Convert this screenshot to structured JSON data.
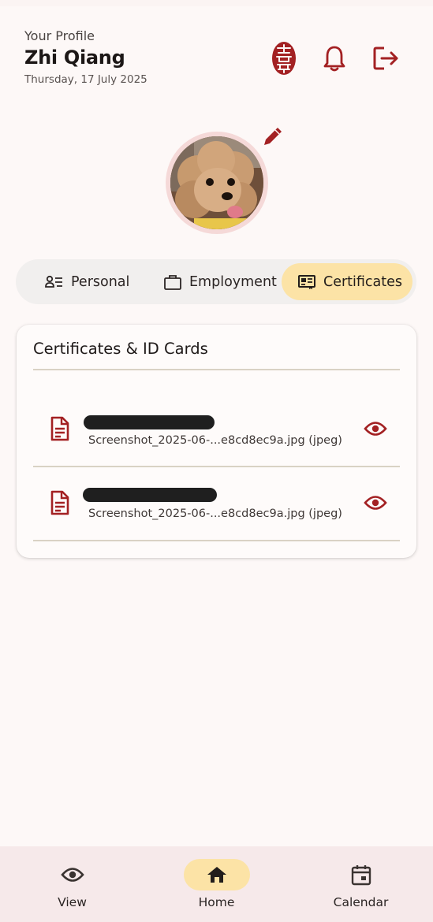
{
  "header": {
    "eyebrow": "Your Profile",
    "name": "Zhi Qiang",
    "date": "Thursday, 17 July 2025"
  },
  "icons": {
    "seal": "seal-logo-icon",
    "notifications": "bell-icon",
    "logout": "logout-icon",
    "edit": "pencil-icon"
  },
  "tabs": [
    {
      "label": "Personal",
      "icon": "person-list-icon",
      "active": false
    },
    {
      "label": "Employment",
      "icon": "briefcase-icon",
      "active": false
    },
    {
      "label": "Certificates",
      "icon": "id-card-icon",
      "active": true
    }
  ],
  "certificates": {
    "title": "Certificates & ID Cards",
    "items": [
      {
        "filename": "Screenshot_2025-06-...e8cd8ec9a.jpg (jpeg)",
        "name_redacted": true
      },
      {
        "filename": "Screenshot_2025-06-...e8cd8ec9a.jpg (jpeg)",
        "name_redacted": true
      }
    ]
  },
  "bottom_nav": [
    {
      "label": "View",
      "icon": "eye-icon",
      "active": false
    },
    {
      "label": "Home",
      "icon": "home-icon",
      "active": true
    },
    {
      "label": "Calendar",
      "icon": "calendar-icon",
      "active": false
    }
  ],
  "colors": {
    "accent": "#a32123",
    "tab_active": "#fce3a6",
    "background": "#fdf8f7",
    "nav_background": "#f6e9ea"
  }
}
